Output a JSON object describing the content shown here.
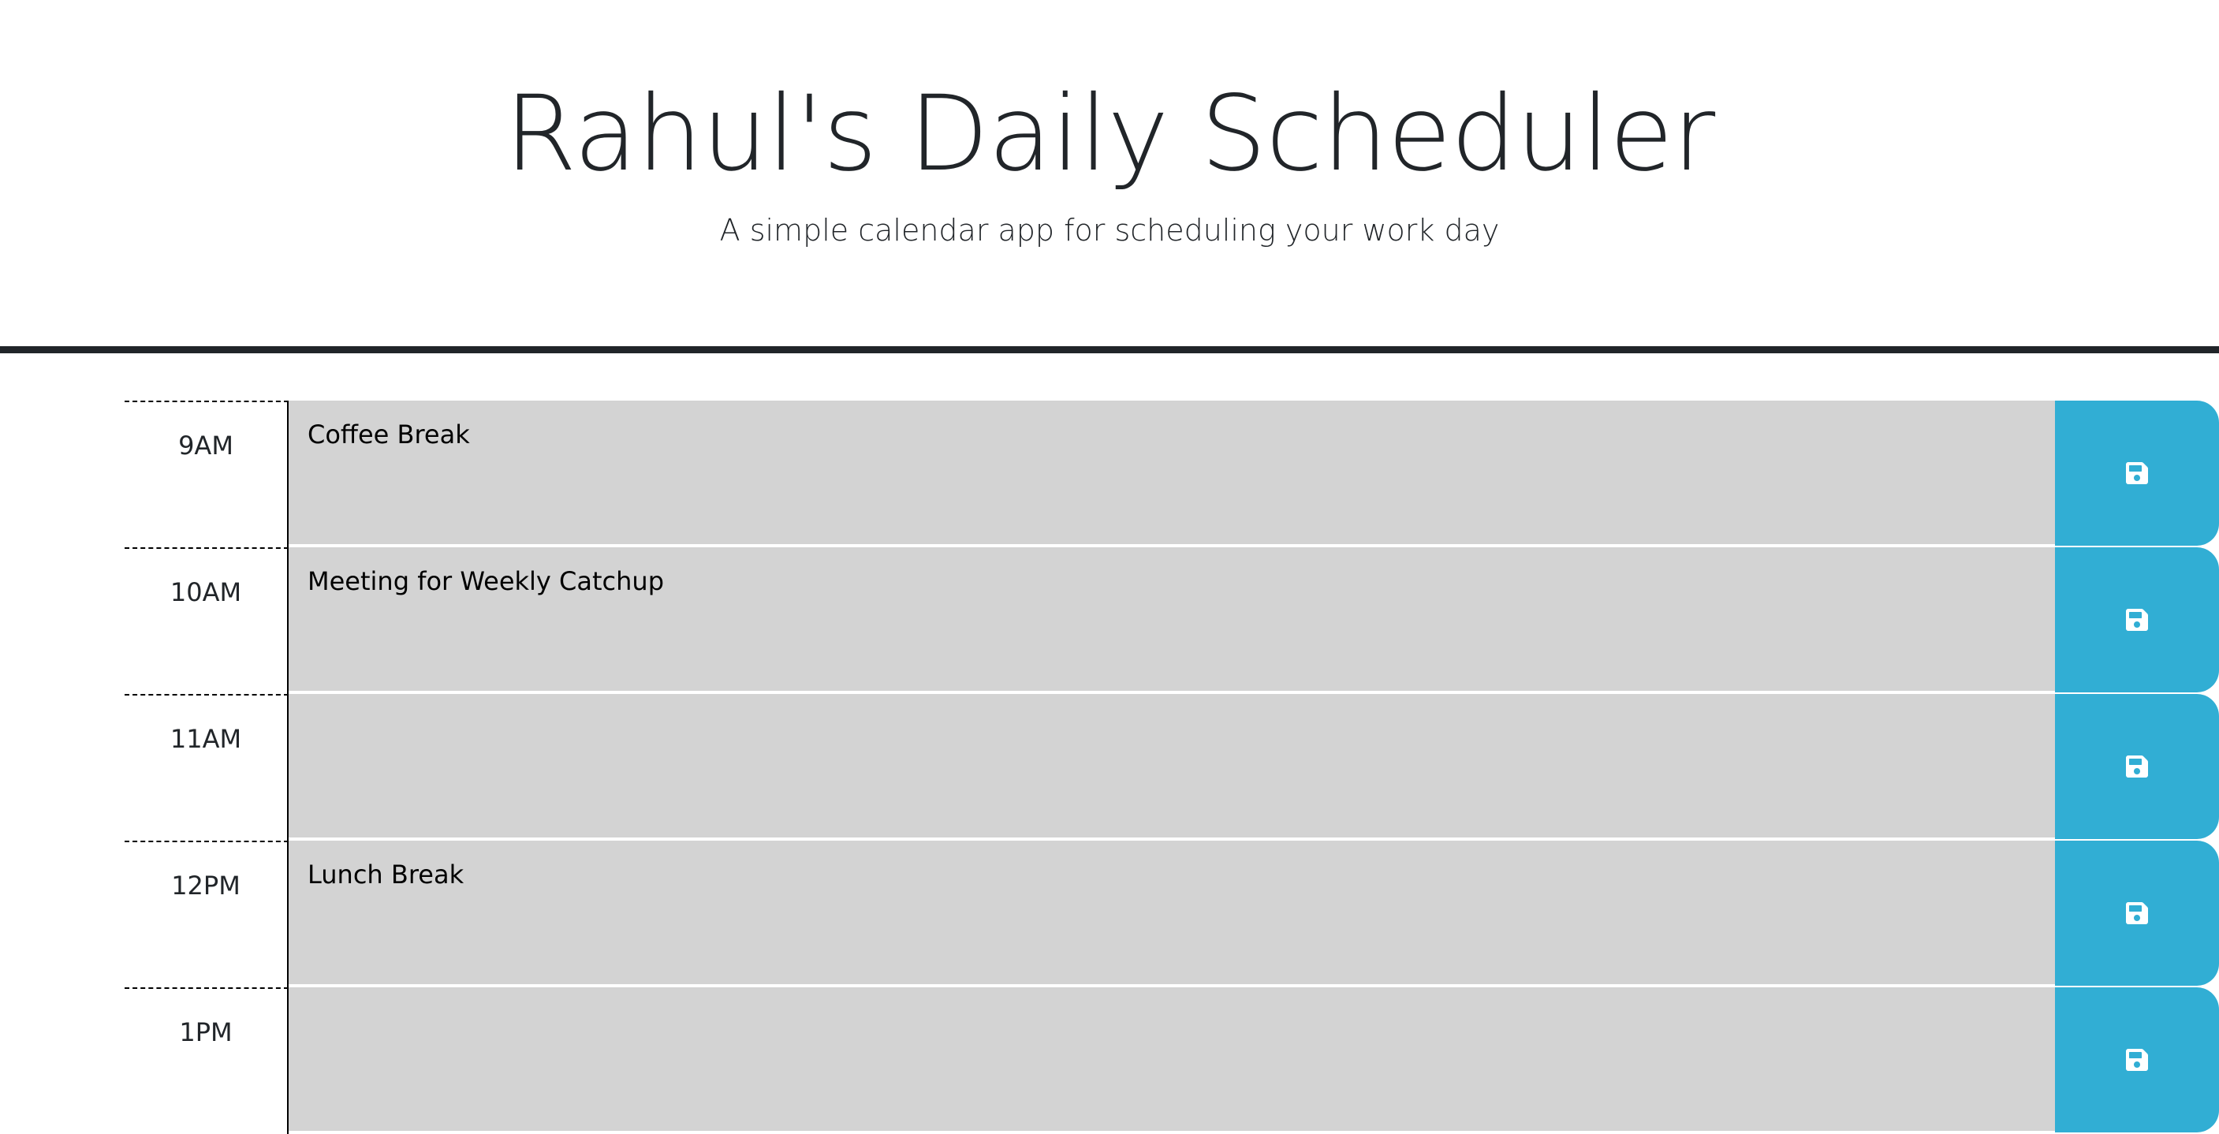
{
  "header": {
    "title": "Rahul's Daily Scheduler",
    "subtitle": "A simple calendar app for scheduling your work day"
  },
  "time_blocks": [
    {
      "hour": "9AM",
      "description": "Coffee Break",
      "save_icon": "save-icon"
    },
    {
      "hour": "10AM",
      "description": "Meeting for Weekly Catchup",
      "save_icon": "save-icon"
    },
    {
      "hour": "11AM",
      "description": "",
      "save_icon": "save-icon"
    },
    {
      "hour": "12PM",
      "description": "Lunch Break",
      "save_icon": "save-icon"
    },
    {
      "hour": "1PM",
      "description": "",
      "save_icon": "save-icon"
    }
  ],
  "colors": {
    "past_block": "#d3d3d3",
    "save_button": "#31aed4",
    "header_rule": "#212529"
  }
}
